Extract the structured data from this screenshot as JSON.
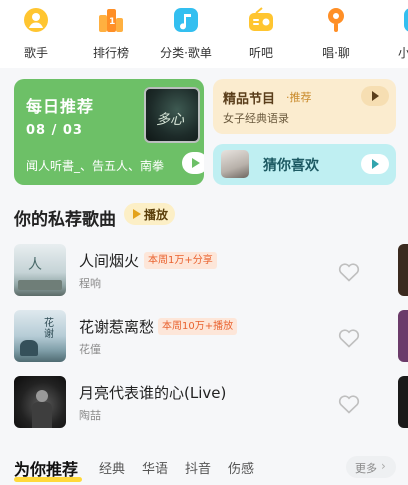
{
  "nav": {
    "items": [
      {
        "label": "歌手",
        "icon": "singer-icon",
        "color": "#ffc530"
      },
      {
        "label": "排行榜",
        "icon": "chart-rank-icon",
        "color": "#ff8f26"
      },
      {
        "label": "分类·歌单",
        "icon": "music-note-icon",
        "color": "#33bff0"
      },
      {
        "label": "听吧",
        "icon": "radio-icon",
        "color": "#ffc530"
      },
      {
        "label": "唱·聊",
        "icon": "microphone-icon",
        "color": "#ff8f26"
      },
      {
        "label": "小",
        "icon": "partial-icon",
        "color": "#33bff0"
      }
    ]
  },
  "daily": {
    "title": "每日推荐",
    "date": "08 / 03",
    "subtitle": "闻人听書_、告五人、南拳",
    "cover_text": "多心",
    "color": "#6dc067"
  },
  "boutique": {
    "title": "精品节目",
    "tag": "·推荐",
    "subtitle": "女子经典语录"
  },
  "guess": {
    "title": "猜你喜欢"
  },
  "section": {
    "title": "你的私荐歌曲",
    "play_label": "播放"
  },
  "songs": [
    {
      "title": "人间烟火",
      "tag": "本周1万+分享",
      "artist": "程响"
    },
    {
      "title": "花谢惹离愁",
      "tag": "本周10万+播放",
      "artist": "花僮"
    },
    {
      "title": "月亮代表谁的心(Live)",
      "tag": "",
      "artist": "陶喆"
    }
  ],
  "tabs": {
    "items": [
      "为你推荐",
      "经典",
      "华语",
      "抖音",
      "伤感"
    ],
    "active": "为你推荐",
    "more_label": "更多"
  },
  "colors": {
    "accent_yellow": "#ffd93a",
    "tag_orange": "#e9622f",
    "guess_bg": "#bfeff2",
    "boutique_bg": "#fbeccf"
  }
}
